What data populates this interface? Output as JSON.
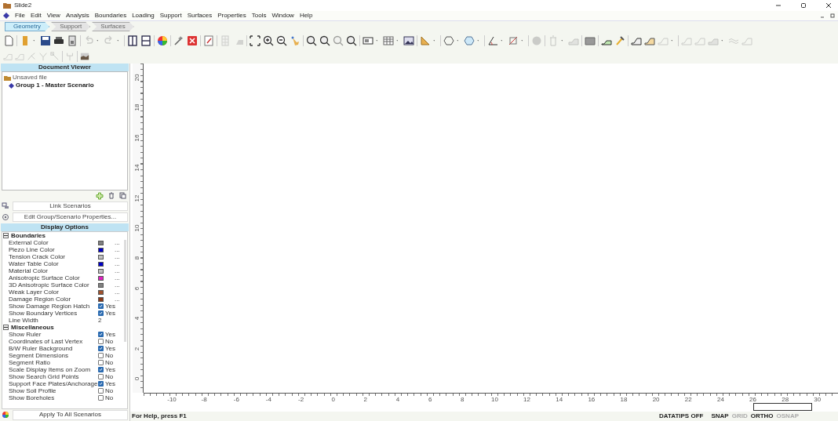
{
  "window": {
    "title": "Slide2"
  },
  "menu": [
    "File",
    "Edit",
    "View",
    "Analysis",
    "Boundaries",
    "Loading",
    "Support",
    "Surfaces",
    "Properties",
    "Tools",
    "Window",
    "Help"
  ],
  "workflow_tabs": [
    {
      "label": "Geometry",
      "selected": true
    },
    {
      "label": "Support",
      "selected": false
    },
    {
      "label": "Surfaces",
      "selected": false
    }
  ],
  "document_viewer": {
    "title": "Document Viewer",
    "tree": [
      {
        "label": "Unsaved file",
        "children": [
          {
            "label": "Group 1 - Master Scenario"
          }
        ]
      }
    ]
  },
  "link_button": "Link Scenarios",
  "edit_button": "Edit Group/Scenario Properties...",
  "display_options": {
    "title": "Display Options",
    "sections": [
      {
        "title": "Boundaries",
        "expanded": true,
        "rows": [
          {
            "kind": "color",
            "label": "External Color",
            "color": "#808080",
            "value": "..."
          },
          {
            "kind": "color",
            "label": "Piezo Line Color",
            "color": "#0000c8",
            "value": "..."
          },
          {
            "kind": "color",
            "label": "Tension Crack Color",
            "color": "#c0c0c0",
            "value": "..."
          },
          {
            "kind": "color",
            "label": "Water Table Color",
            "color": "#0000c8",
            "value": "..."
          },
          {
            "kind": "color",
            "label": "Material Color",
            "color": "#c0c0c0",
            "value": "..."
          },
          {
            "kind": "color",
            "label": "Anisotropic Surface Color",
            "color": "#e020c0",
            "value": "..."
          },
          {
            "kind": "color",
            "label": "3D Anisotropic Surface Color",
            "color": "#808080",
            "value": "..."
          },
          {
            "kind": "color",
            "label": "Weak Layer Color",
            "color": "#a0522d",
            "value": "..."
          },
          {
            "kind": "color",
            "label": "Damage Region Color",
            "color": "#8b3a1a",
            "value": "..."
          },
          {
            "kind": "check",
            "label": "Show Damage Region Hatch",
            "checked": true,
            "value": "Yes"
          },
          {
            "kind": "check",
            "label": "Show Boundary Vertices",
            "checked": true,
            "value": "Yes"
          },
          {
            "kind": "text",
            "label": "Line Width",
            "value": "2"
          }
        ]
      },
      {
        "title": "Miscellaneous",
        "expanded": true,
        "rows": [
          {
            "kind": "check",
            "label": "Show Ruler",
            "checked": true,
            "value": "Yes"
          },
          {
            "kind": "check",
            "label": "Coordinates of Last Vertex",
            "checked": false,
            "value": "No"
          },
          {
            "kind": "check",
            "label": "B/W Ruler Background",
            "checked": true,
            "value": "Yes"
          },
          {
            "kind": "check",
            "label": "Segment Dimensions",
            "checked": false,
            "value": "No"
          },
          {
            "kind": "check",
            "label": "Segment Ratio",
            "checked": false,
            "value": "No"
          },
          {
            "kind": "check",
            "label": "Scale Display Items on Zoom",
            "checked": true,
            "value": "Yes"
          },
          {
            "kind": "check",
            "label": "Show Search Grid Points",
            "checked": false,
            "value": "No"
          },
          {
            "kind": "check",
            "label": "Support Face Plates/Anchorage",
            "checked": true,
            "value": "Yes"
          },
          {
            "kind": "check",
            "label": "Show Soil Profile",
            "checked": false,
            "value": "No"
          },
          {
            "kind": "check",
            "label": "Show Boreholes",
            "checked": false,
            "value": "No"
          }
        ]
      }
    ]
  },
  "apply_button": "Apply To All Scenarios",
  "ruler": {
    "vertical": [
      "20",
      "18",
      "16",
      "14",
      "12",
      "10",
      "8",
      "6",
      "4",
      "2",
      "0"
    ],
    "horizontal": [
      "-10",
      "-8",
      "-6",
      "-4",
      "-2",
      "0",
      "2",
      "4",
      "6",
      "8",
      "10",
      "12",
      "14",
      "16",
      "18",
      "20",
      "22",
      "24",
      "26",
      "28",
      "30"
    ]
  },
  "status_bar": {
    "help": "For Help, press F1",
    "indicators": [
      {
        "label": "DATATIPS OFF",
        "on": true
      },
      {
        "label": "SNAP",
        "on": true
      },
      {
        "label": "GRID",
        "on": false
      },
      {
        "label": "ORTHO",
        "on": true
      },
      {
        "label": "OSNAP",
        "on": false
      }
    ]
  }
}
